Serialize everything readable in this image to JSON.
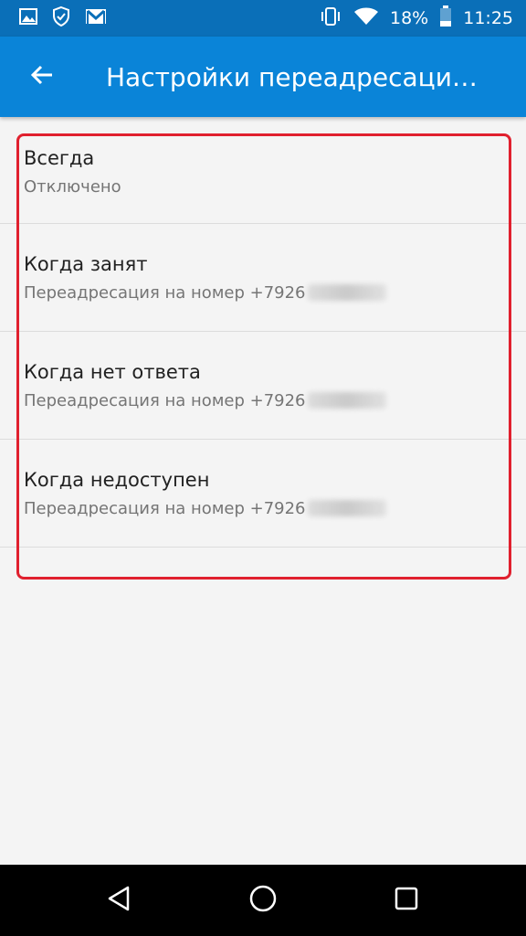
{
  "status_bar": {
    "battery_percent": "18%",
    "time": "11:25",
    "icons_left": [
      "image-icon",
      "shield-check-icon",
      "gmail-icon"
    ],
    "icons_right": [
      "vibrate-icon",
      "wifi-icon",
      "battery-icon"
    ]
  },
  "app_bar": {
    "title": "Настройки переадресаци…",
    "back_icon": "arrow-back-icon"
  },
  "forwarding_items": [
    {
      "title": "Всегда",
      "summary": "Отключено"
    },
    {
      "title": "Когда занят",
      "summary": "Переадресация на номер +7926"
    },
    {
      "title": "Когда нет ответа",
      "summary": "Переадресация на номер +7926"
    },
    {
      "title": "Когда недоступен",
      "summary": "Переадресация на номер +7926"
    }
  ],
  "colors": {
    "status_bar": "#0a6fb8",
    "app_bar": "#0a84d8",
    "highlight": "#e0202e",
    "background": "#f4f4f4"
  },
  "nav_bar": {
    "buttons": [
      "back-triangle-icon",
      "home-circle-icon",
      "recents-square-icon"
    ]
  }
}
